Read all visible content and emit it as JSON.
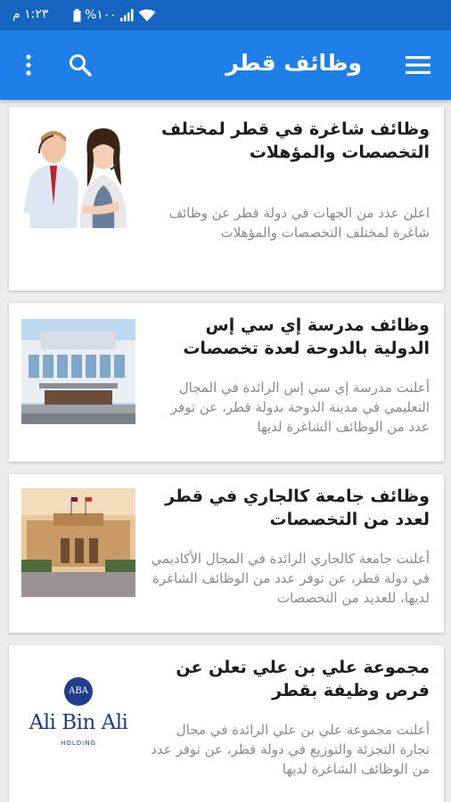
{
  "status_bar": {
    "time": "١:٢٣ م",
    "battery": "١٠٠%"
  },
  "app_bar": {
    "title": "وظائف قطر",
    "icons": [
      "menu-icon",
      "search-icon",
      "more-vert-icon"
    ]
  },
  "articles": [
    {
      "title": "وظائف شاغرة في قطر لمختلف التخصصات والمؤهلات",
      "summary": "اعلن عدد من الجهات في دولة قطر عن وظائف شاغرة لمختلف التخصصات والمؤهلات",
      "thumbnail": "call-center-agents"
    },
    {
      "title": "وظائف مدرسة إي سي إس الدولية بالدوحة لعدة تخصصات",
      "summary": "أعلنت مدرسة إي سي إس الرائدة في المجال التعليمي في مدينة الدوحة بدولة قطر، عن توفر عدد من الوظائف الشاغرة لديها",
      "thumbnail": "school-building"
    },
    {
      "title": "وظائف جامعة كالجاري في قطر لعدد من التخصصات",
      "summary": "أعلنت جامعة كالجاري الرائدة في المجال الأكاديمي في دولة قطر، عن توفر عدد من الوظائف الشاغرة لديها، للعديد من التخصصات",
      "thumbnail": "university-building"
    },
    {
      "title": "مجموعة علي بن علي تعلن عن فرص وظيفة بقطر",
      "summary": "أعلنت مجموعة علي بن علي الرائدة في مجال تجارة التجزئة والتوزيع في دولة قطر، عن توفر عدد من الوظائف الشاغرة لديها",
      "thumbnail": "company-logo",
      "logo_text": "Ali Bin Ali",
      "logo_subtext": "HOLDING",
      "logo_monogram": "ABA"
    }
  ],
  "colors": {
    "status_bar": "#1565c0",
    "app_bar": "#1e7fe8",
    "background": "#ececec",
    "card": "#ffffff",
    "title_text": "#1e1e1e",
    "summary_text": "#8a8a8a",
    "logo_blue": "#1f3d8a"
  }
}
